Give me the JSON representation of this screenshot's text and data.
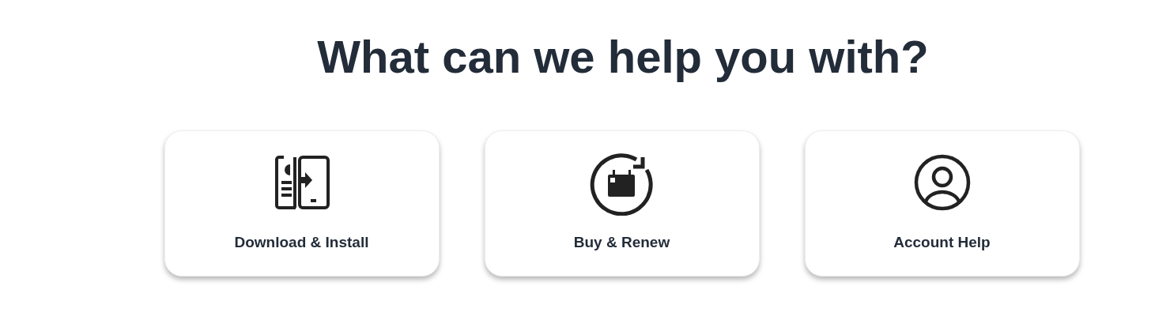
{
  "heading": "What can we help you with?",
  "cards": [
    {
      "kind": "devices",
      "label": "Download & Install"
    },
    {
      "kind": "renew",
      "label": "Buy & Renew"
    },
    {
      "kind": "account",
      "label": "Account Help"
    }
  ]
}
